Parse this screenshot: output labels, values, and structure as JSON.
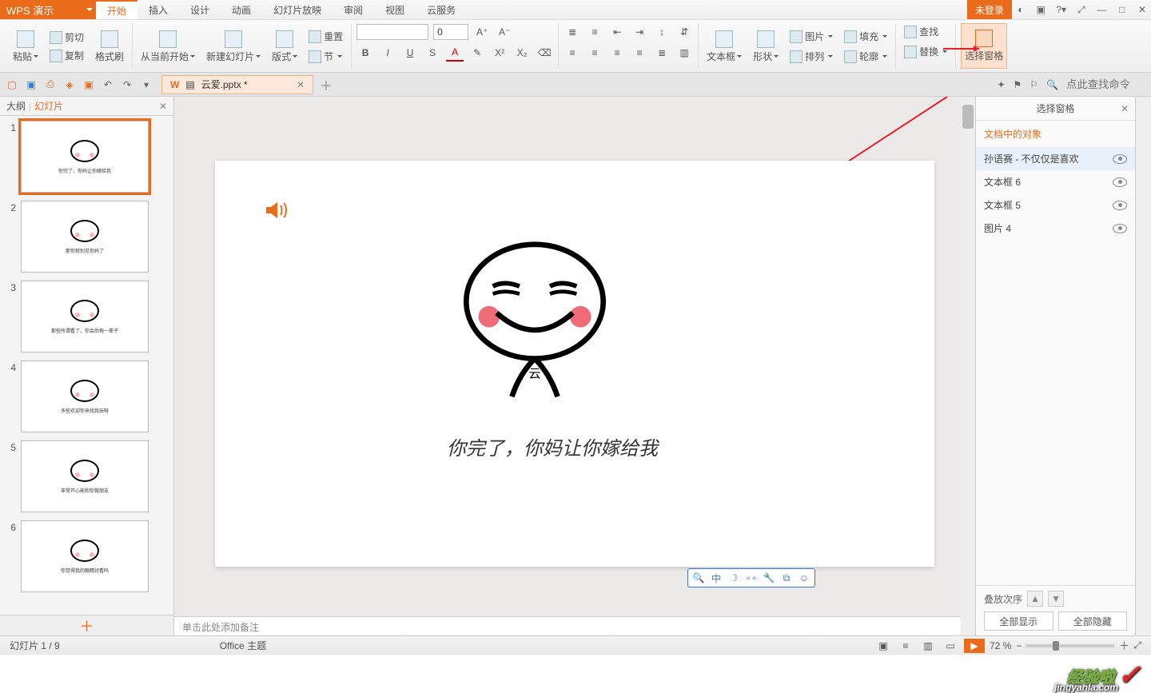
{
  "title_app": "WPS 演示",
  "login": "未登录",
  "menu": [
    "开始",
    "插入",
    "设计",
    "动画",
    "幻灯片放映",
    "审阅",
    "视图",
    "云服务"
  ],
  "ribbon": {
    "paste": "粘贴",
    "cut": "剪切",
    "copy": "复制",
    "fmtbrush": "格式刷",
    "from_current": "从当前开始",
    "new_slide": "新建幻灯片",
    "layout": "版式",
    "reset": "重置",
    "section": "节",
    "font_size": "0",
    "textbox": "文本框",
    "shape": "形状",
    "image": "图片",
    "fill": "填充",
    "arrange": "排列",
    "outline": "轮廓",
    "find": "查找",
    "replace": "替换",
    "select": "选择",
    "select_pane": "选择窗格"
  },
  "doc_tab": "云爱.pptx *",
  "search_placeholder": "点此查找命令",
  "nav": {
    "outline": "大纲",
    "slides": "幻灯片"
  },
  "thumbs": [
    {
      "n": "1",
      "cap": "你完了，你妈让你嫁给我"
    },
    {
      "n": "2",
      "cap": "那你就别见你妈了"
    },
    {
      "n": "3",
      "cap": "那些所谓看了，你会后悔一辈子"
    },
    {
      "n": "4",
      "cap": "多些欢迎你来找我玩呀"
    },
    {
      "n": "5",
      "cap": "非常开心能和你做朋友"
    },
    {
      "n": "6",
      "cap": "你觉得我的眼睛好看吗"
    }
  ],
  "canvas": {
    "caption": "你完了，你妈让你嫁给我",
    "yun": "云"
  },
  "notes_placeholder": "单击此处添加备注",
  "sel": {
    "title": "选择窗格",
    "sub": "文档中的对象",
    "items": [
      "孙语赛 - 不仅仅是喜欢",
      "文本框 6",
      "文本框 5",
      "图片 4"
    ],
    "layer": "叠放次序",
    "show_all": "全部显示",
    "hide_all": "全部隐藏"
  },
  "status": {
    "slide": "幻灯片 1 / 9",
    "theme": "Office 主题",
    "zoom": "72 %"
  },
  "watermark": {
    "cn": "经验啦",
    "en": "jingyanla.com"
  }
}
